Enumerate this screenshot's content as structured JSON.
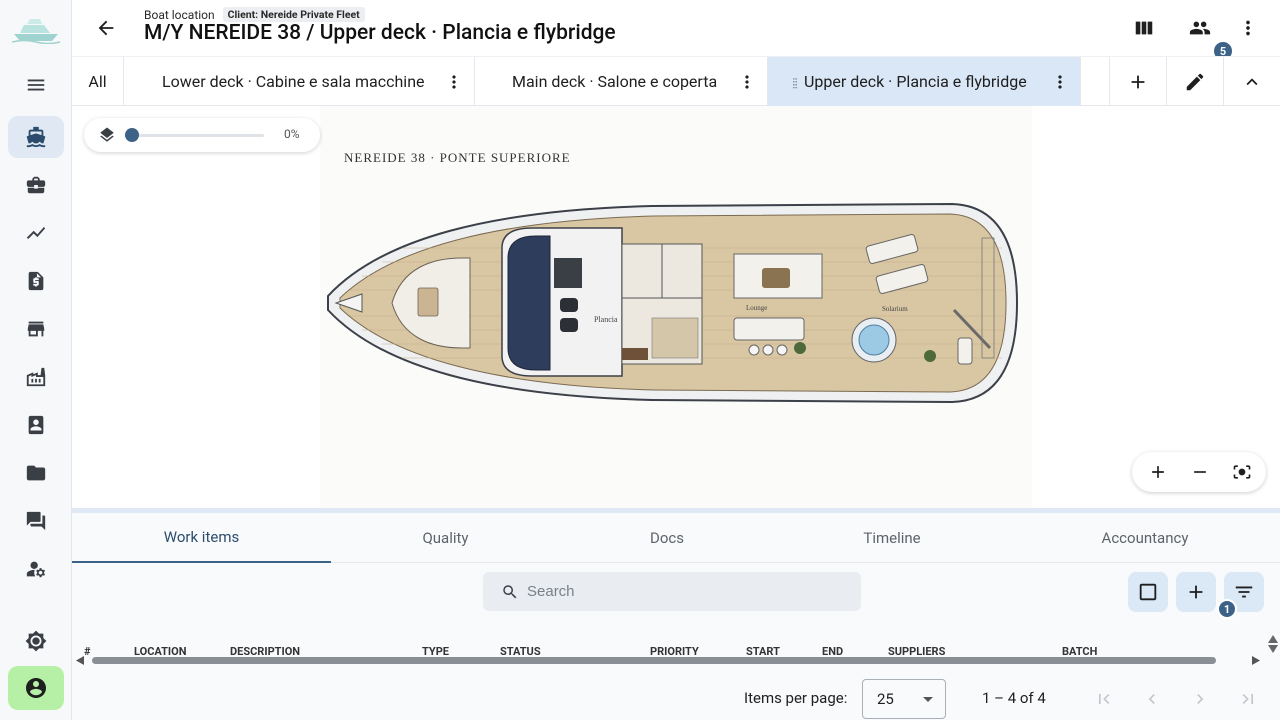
{
  "header": {
    "breadcrumb": "Boat location",
    "client_chip": "Client: Nereide Private Fleet",
    "title": "M/Y NEREIDE 38 / Upper deck · Plancia e flybridge",
    "users_badge": "5"
  },
  "deck_tabs": {
    "all_label": "All",
    "items": [
      {
        "label": "Lower deck · Cabine e sala macchine"
      },
      {
        "label": "Main deck · Salone e coperta"
      },
      {
        "label": "Upper deck · Plancia e flybridge"
      }
    ]
  },
  "layer_slider": {
    "value": 0,
    "value_label": "0%"
  },
  "plan": {
    "title": "NEREIDE 38 · PONTE SUPERIORE",
    "labels": {
      "helm": "Plancia",
      "lounge": "Lounge",
      "solarium": "Solarium"
    }
  },
  "bottom_tabs": [
    {
      "label": "Work items"
    },
    {
      "label": "Quality"
    },
    {
      "label": "Docs"
    },
    {
      "label": "Timeline"
    },
    {
      "label": "Accountancy"
    }
  ],
  "search": {
    "placeholder": "Search"
  },
  "filter_badge": "1",
  "table": {
    "columns": [
      "#",
      "LOCATION",
      "DESCRIPTION",
      "TYPE",
      "STATUS",
      "PRIORITY",
      "START",
      "END",
      "SUPPLIERS",
      "BATCH"
    ]
  },
  "pagination": {
    "items_per_page_label": "Items per page:",
    "page_size": "25",
    "range": "1 – 4 of 4"
  },
  "colors": {
    "accent": "#3d6288",
    "active_tab_bg": "#d9e7f6",
    "profile_bg": "#b6f0a7",
    "deck_wood": "#d9c7a3"
  }
}
